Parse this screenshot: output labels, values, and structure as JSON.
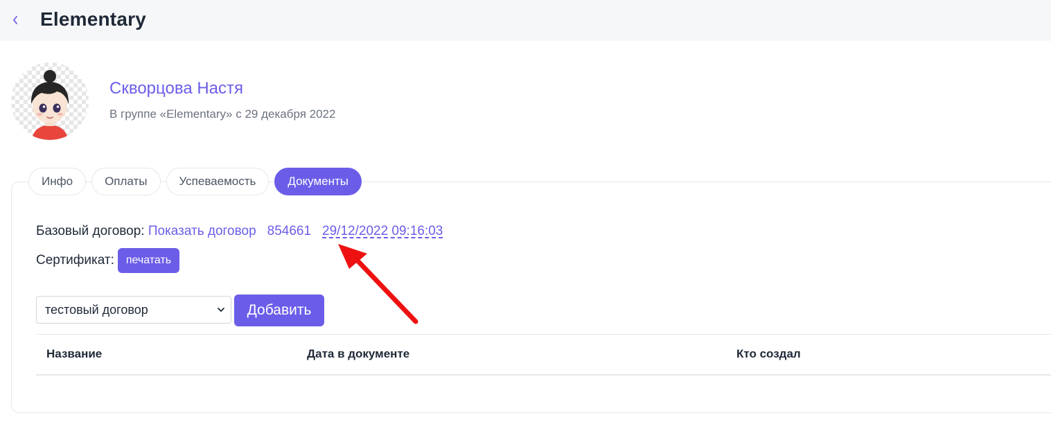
{
  "header": {
    "title": "Elementary"
  },
  "profile": {
    "name": "Скворцова Настя",
    "subtitle": "В группе «Elementary» с 29 декабря 2022"
  },
  "tabs": [
    {
      "label": "Инфо",
      "active": false
    },
    {
      "label": "Оплаты",
      "active": false
    },
    {
      "label": "Успеваемость",
      "active": false
    },
    {
      "label": "Документы",
      "active": true
    }
  ],
  "documents": {
    "base_contract_label": "Базовый договор:",
    "show_contract_link": "Показать договор",
    "contract_number": "854661",
    "contract_datetime": "29/12/2022 09:16:03",
    "certificate_label": "Сертификат:",
    "print_button": "печатать",
    "template_select_value": "тестовый договор",
    "add_button": "Добавить"
  },
  "table": {
    "columns": [
      "Название",
      "Дата в документе",
      "Кто создал"
    ]
  },
  "colors": {
    "accent": "#6b5de8",
    "arrow": "#ee1111"
  }
}
